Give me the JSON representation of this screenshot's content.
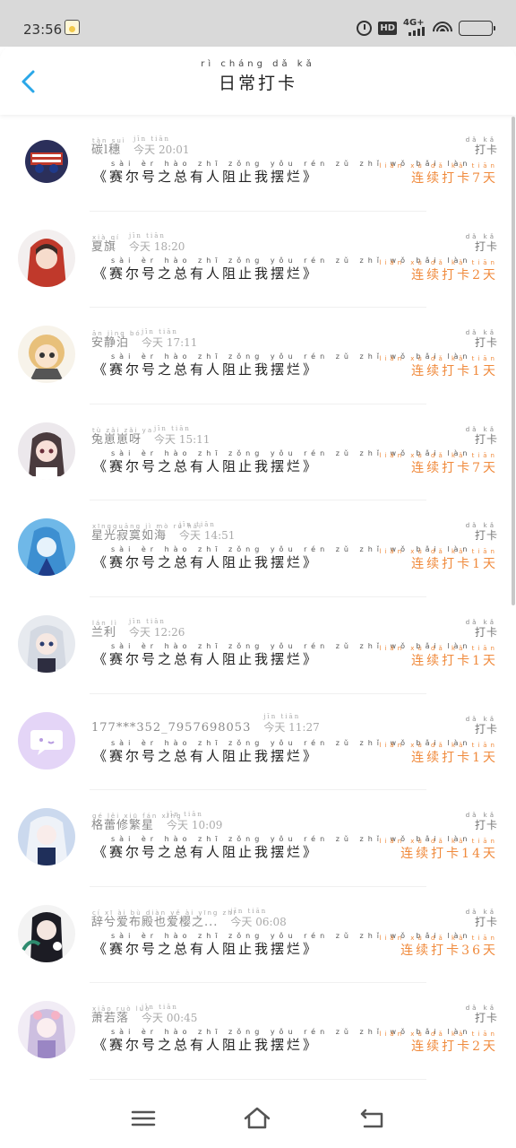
{
  "status_bar": {
    "time": "23:56",
    "hd_label": "HD",
    "network_label": "4G+",
    "icons": [
      "app-notification-icon",
      "alarm-icon",
      "hd-icon",
      "signal-icon",
      "wifi-icon",
      "battery-icon"
    ]
  },
  "header": {
    "title": "日常打卡",
    "title_pinyin": "rì cháng dǎ kǎ",
    "back_icon": "chevron-left-icon",
    "accent_color": "#2aa7e8"
  },
  "list": {
    "items": [
      {
        "name": "碳l穗",
        "name_py": "tàn      suì",
        "time": "今天 20:01",
        "time_py": "jīn tiān",
        "text": "《赛尔号之总有人阻止我摆烂》",
        "text_py": "sài èr hào zhī zǒng yǒu rén zǔ zhǐ wǒ bǎi làn",
        "type": "打卡",
        "type_py": "dǎ kǎ",
        "streak": "连续打卡7天",
        "streak_py": "lián xù dǎ kǎ tiān"
      },
      {
        "name": "夏旗",
        "name_py": "xià qí",
        "time": "今天 18:20",
        "time_py": "jīn tiān",
        "text": "《赛尔号之总有人阻止我摆烂》",
        "text_py": "sài èr hào zhī zǒng yǒu rén zǔ zhǐ wǒ bǎi làn",
        "type": "打卡",
        "type_py": "dǎ kǎ",
        "streak": "连续打卡2天",
        "streak_py": "lián xù dǎ kǎ tiān"
      },
      {
        "name": "安静泊",
        "name_py": "ān jìng bó",
        "time": "今天 17:11",
        "time_py": "jīn tiān",
        "text": "《赛尔号之总有人阻止我摆烂》",
        "text_py": "sài èr hào zhī zǒng yǒu rén zǔ zhǐ wǒ bǎi làn",
        "type": "打卡",
        "type_py": "dǎ kǎ",
        "streak": "连续打卡1天",
        "streak_py": "lián xù dǎ kǎ tiān"
      },
      {
        "name": "兔崽崽呀",
        "name_py": "tù zǎi zǎi ya",
        "time": "今天 15:11",
        "time_py": "jīn tiān",
        "text": "《赛尔号之总有人阻止我摆烂》",
        "text_py": "sài èr hào zhī zǒng yǒu rén zǔ zhǐ wǒ bǎi làn",
        "type": "打卡",
        "type_py": "dǎ kǎ",
        "streak": "连续打卡7天",
        "streak_py": "lián xù dǎ kǎ tiān"
      },
      {
        "name": "星光寂寞如海",
        "name_py": "xīngguāng jì mò rú hǎi",
        "time": "今天 14:51",
        "time_py": "jīn tiān",
        "text": "《赛尔号之总有人阻止我摆烂》",
        "text_py": "sài èr hào zhī zǒng yǒu rén zǔ zhǐ wǒ bǎi làn",
        "type": "打卡",
        "type_py": "dǎ kǎ",
        "streak": "连续打卡1天",
        "streak_py": "lián xù dǎ kǎ tiān"
      },
      {
        "name": "兰利",
        "name_py": "lán lì",
        "time": "今天 12:26",
        "time_py": "jīn tiān",
        "text": "《赛尔号之总有人阻止我摆烂》",
        "text_py": "sài èr hào zhī zǒng yǒu rén zǔ zhǐ wǒ bǎi làn",
        "type": "打卡",
        "type_py": "dǎ kǎ",
        "streak": "连续打卡1天",
        "streak_py": "lián xù dǎ kǎ tiān"
      },
      {
        "name": "177***352_7957698053",
        "name_py": "",
        "time": "今天 11:27",
        "time_py": "jīn tiān",
        "text": "《赛尔号之总有人阻止我摆烂》",
        "text_py": "sài èr hào zhī zǒng yǒu rén zǔ zhǐ wǒ bǎi làn",
        "type": "打卡",
        "type_py": "dǎ kǎ",
        "streak": "连续打卡1天",
        "streak_py": "lián xù dǎ kǎ tiān"
      },
      {
        "name": "格蕾修繁星",
        "name_py": "gé lěi xiū fán xīng",
        "time": "今天 10:09",
        "time_py": "jīn tiān",
        "text": "《赛尔号之总有人阻止我摆烂》",
        "text_py": "sài èr hào zhī zǒng yǒu rén zǔ zhǐ wǒ bǎi làn",
        "type": "打卡",
        "type_py": "dǎ kǎ",
        "streak": "连续打卡14天",
        "streak_py": "lián xù dǎ kǎ tiān"
      },
      {
        "name": "辞兮爱布殿也爱樱之...",
        "name_py": "cí xī ài bù diàn yě ài yīng zhī",
        "time": "今天 06:08",
        "time_py": "jīn tiān",
        "text": "《赛尔号之总有人阻止我摆烂》",
        "text_py": "sài èr hào zhī zǒng yǒu rén zǔ zhǐ wǒ bǎi làn",
        "type": "打卡",
        "type_py": "dǎ kǎ",
        "streak": "连续打卡36天",
        "streak_py": "lián xù dǎ kǎ tiān"
      },
      {
        "name": "萧若落",
        "name_py": "xiāo ruò luò",
        "time": "今天 00:45",
        "time_py": "jīn tiān",
        "text": "《赛尔号之总有人阻止我摆烂》",
        "text_py": "sài èr hào zhī zǒng yǒu rén zǔ zhǐ wǒ bǎi làn",
        "type": "打卡",
        "type_py": "dǎ kǎ",
        "streak": "连续打卡2天",
        "streak_py": "lián xù dǎ kǎ tiān"
      }
    ]
  },
  "colors": {
    "streak": "#f08a3c",
    "name": "#8a8a8a",
    "time": "#aaaaaa",
    "back_arrow": "#2aa7e8"
  },
  "nav_bar": {
    "icons": [
      "menu-icon",
      "home-icon",
      "back-icon"
    ]
  }
}
